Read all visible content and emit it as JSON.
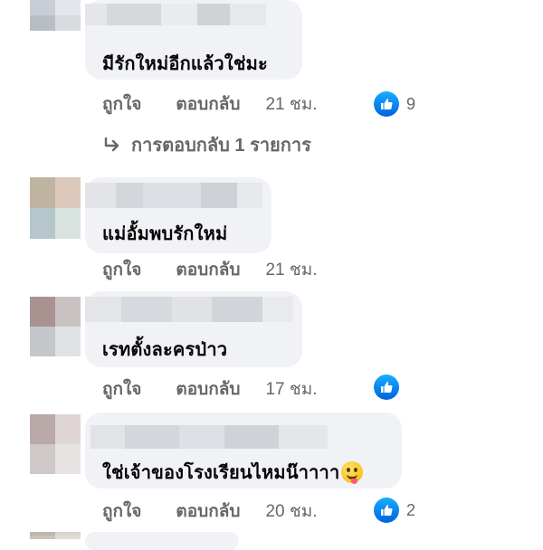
{
  "actions": {
    "like": "ถูกใจ",
    "reply": "ตอบกลับ"
  },
  "comments": [
    {
      "text": "มีรักใหม่อีกแล้วใช่มะ",
      "time": "21 ชม.",
      "reaction_count": "9",
      "reaction_icon": "like-icon"
    },
    {
      "text": "แม่อั้มพบรักใหม่",
      "time": "21 ชม."
    },
    {
      "text": "เรทตั้งละครป่าว",
      "time": "17 ชม.",
      "reaction_icon": "like-icon"
    },
    {
      "text": "ใช่เจ้าของโรงเรียนไหมน๊าาาา",
      "emoji": "winking-tongue-emoji",
      "time": "20 ชม.",
      "reaction_count": "2",
      "reaction_icon": "like-icon"
    }
  ],
  "replies_link": {
    "label": "การตอบกลับ 1 รายการ",
    "icon": "reply-arrow-icon"
  },
  "colors": {
    "bubble": "#f0f2f5",
    "muted_text": "#65676b",
    "like_blue": "#1877f2"
  }
}
